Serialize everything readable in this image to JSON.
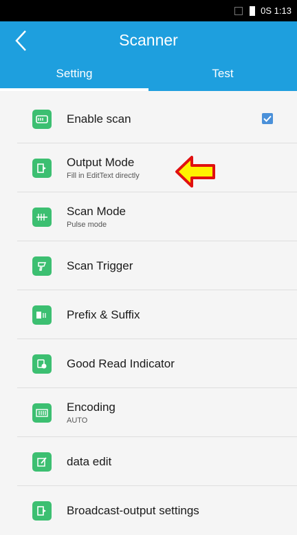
{
  "status_bar": {
    "time": "0S 1:13"
  },
  "header": {
    "title": "Scanner"
  },
  "tabs": [
    {
      "label": "Setting",
      "active": true
    },
    {
      "label": "Test",
      "active": false
    }
  ],
  "settings": [
    {
      "icon": "scanner-icon",
      "label": "Enable scan",
      "sub": "",
      "checked": true
    },
    {
      "icon": "output-mode-icon",
      "label": "Output Mode",
      "sub": "Fill in EditText directly"
    },
    {
      "icon": "scan-mode-icon",
      "label": "Scan Mode",
      "sub": "Pulse mode"
    },
    {
      "icon": "scan-trigger-icon",
      "label": "Scan Trigger",
      "sub": ""
    },
    {
      "icon": "prefix-suffix-icon",
      "label": "Prefix & Suffix",
      "sub": ""
    },
    {
      "icon": "good-read-indicator-icon",
      "label": "Good Read Indicator",
      "sub": ""
    },
    {
      "icon": "encoding-icon",
      "label": "Encoding",
      "sub": "AUTO"
    },
    {
      "icon": "data-edit-icon",
      "label": "data edit",
      "sub": ""
    },
    {
      "icon": "broadcast-output-icon",
      "label": "Broadcast-output settings",
      "sub": ""
    }
  ],
  "colors": {
    "toolbar": "#1e9fde",
    "icon_green": "#3cbf71",
    "checkbox": "#4a90d9",
    "callout_arrow_fill": "#fff200",
    "callout_arrow_stroke": "#e01010"
  }
}
